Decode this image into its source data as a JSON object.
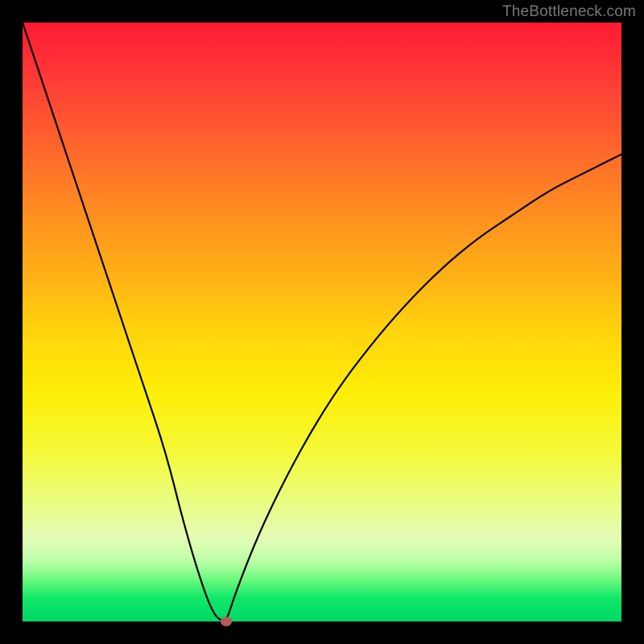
{
  "watermark": "TheBottleneck.com",
  "chart_data": {
    "type": "line",
    "title": "",
    "xlabel": "",
    "ylabel": "",
    "xlim": [
      0,
      100
    ],
    "ylim": [
      0,
      100
    ],
    "grid": false,
    "legend": false,
    "series": [
      {
        "name": "bottleneck_curve",
        "x": [
          0,
          4,
          8,
          12,
          16,
          20,
          24,
          27,
          30,
          32,
          33.5,
          34,
          36,
          40,
          46,
          52,
          58,
          64,
          70,
          76,
          82,
          88,
          94,
          100
        ],
        "y": [
          100,
          88,
          76,
          64,
          52,
          40,
          28,
          16,
          6,
          1,
          0,
          0,
          6,
          16,
          28,
          38,
          46,
          53,
          59,
          64,
          68,
          72,
          75,
          78
        ]
      }
    ],
    "annotations": [
      {
        "type": "dot",
        "x": 34,
        "y": 0,
        "color": "#b85959"
      }
    ],
    "background_gradient": {
      "direction": "vertical",
      "stops": [
        {
          "pos": 0.0,
          "color": "#ff1a33"
        },
        {
          "pos": 0.22,
          "color": "#ff6a2b"
        },
        {
          "pos": 0.52,
          "color": "#ffd50c"
        },
        {
          "pos": 0.8,
          "color": "#eafd81"
        },
        {
          "pos": 0.93,
          "color": "#6cf97d"
        },
        {
          "pos": 1.0,
          "color": "#00d864"
        }
      ]
    }
  }
}
